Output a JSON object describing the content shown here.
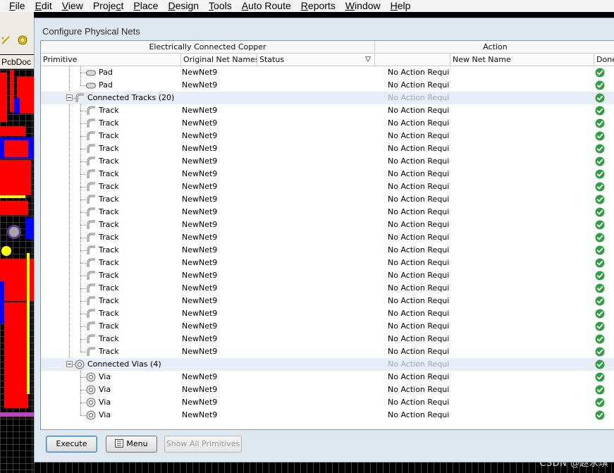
{
  "menu": [
    {
      "label": "File",
      "u": "F"
    },
    {
      "label": "Edit",
      "u": "E"
    },
    {
      "label": "View",
      "u": "V"
    },
    {
      "label": "Project",
      "u": "c"
    },
    {
      "label": "Place",
      "u": "P"
    },
    {
      "label": "Design",
      "u": "D"
    },
    {
      "label": "Tools",
      "u": "T"
    },
    {
      "label": "Auto Route",
      "u": "A"
    },
    {
      "label": "Reports",
      "u": "R"
    },
    {
      "label": "Window",
      "u": "W"
    },
    {
      "label": "Help",
      "u": "H"
    }
  ],
  "editor_tab": "PcbDoc *",
  "dialog": {
    "title": "Configure Physical Nets",
    "headers": {
      "group_copper": "Electrically Connected Copper",
      "group_action": "Action",
      "primitive": "Primitive",
      "original_net": "Original Net Names",
      "status": "Status",
      "new_net": "New Net Name",
      "done": "Done"
    },
    "rows": [
      {
        "kind": "item",
        "icon": "pad-icon",
        "primitive": "Pad",
        "net": "NewNet9",
        "action": "No Action Requir",
        "done": true
      },
      {
        "kind": "item",
        "icon": "pad-icon",
        "primitive": "Pad",
        "net": "NewNet9",
        "action": "No Action Requir",
        "done": true
      },
      {
        "kind": "group",
        "icon": "track-icon",
        "primitive": "Connected Tracks (20)",
        "net": "",
        "action": "No Action Requir",
        "done": true
      },
      {
        "kind": "item",
        "icon": "track-icon",
        "primitive": "Track",
        "net": "NewNet9",
        "action": "No Action Requir",
        "done": true
      },
      {
        "kind": "item",
        "icon": "track-icon",
        "primitive": "Track",
        "net": "NewNet9",
        "action": "No Action Requir",
        "done": true
      },
      {
        "kind": "item",
        "icon": "track-icon",
        "primitive": "Track",
        "net": "NewNet9",
        "action": "No Action Requir",
        "done": true
      },
      {
        "kind": "item",
        "icon": "track-icon",
        "primitive": "Track",
        "net": "NewNet9",
        "action": "No Action Requir",
        "done": true
      },
      {
        "kind": "item",
        "icon": "track-icon",
        "primitive": "Track",
        "net": "NewNet9",
        "action": "No Action Requir",
        "done": true
      },
      {
        "kind": "item",
        "icon": "track-icon",
        "primitive": "Track",
        "net": "NewNet9",
        "action": "No Action Requir",
        "done": true
      },
      {
        "kind": "item",
        "icon": "track-icon",
        "primitive": "Track",
        "net": "NewNet9",
        "action": "No Action Requir",
        "done": true
      },
      {
        "kind": "item",
        "icon": "track-icon",
        "primitive": "Track",
        "net": "NewNet9",
        "action": "No Action Requir",
        "done": true
      },
      {
        "kind": "item",
        "icon": "track-icon",
        "primitive": "Track",
        "net": "NewNet9",
        "action": "No Action Requir",
        "done": true
      },
      {
        "kind": "item",
        "icon": "track-icon",
        "primitive": "Track",
        "net": "NewNet9",
        "action": "No Action Requir",
        "done": true
      },
      {
        "kind": "item",
        "icon": "track-icon",
        "primitive": "Track",
        "net": "NewNet9",
        "action": "No Action Requir",
        "done": true
      },
      {
        "kind": "item",
        "icon": "track-icon",
        "primitive": "Track",
        "net": "NewNet9",
        "action": "No Action Requir",
        "done": true
      },
      {
        "kind": "item",
        "icon": "track-icon",
        "primitive": "Track",
        "net": "NewNet9",
        "action": "No Action Requir",
        "done": true
      },
      {
        "kind": "item",
        "icon": "track-icon",
        "primitive": "Track",
        "net": "NewNet9",
        "action": "No Action Requir",
        "done": true
      },
      {
        "kind": "item",
        "icon": "track-icon",
        "primitive": "Track",
        "net": "NewNet9",
        "action": "No Action Requir",
        "done": true
      },
      {
        "kind": "item",
        "icon": "track-icon",
        "primitive": "Track",
        "net": "NewNet9",
        "action": "No Action Requir",
        "done": true
      },
      {
        "kind": "item",
        "icon": "track-icon",
        "primitive": "Track",
        "net": "NewNet9",
        "action": "No Action Requir",
        "done": true
      },
      {
        "kind": "item",
        "icon": "track-icon",
        "primitive": "Track",
        "net": "NewNet9",
        "action": "No Action Requir",
        "done": true
      },
      {
        "kind": "item",
        "icon": "track-icon",
        "primitive": "Track",
        "net": "NewNet9",
        "action": "No Action Requir",
        "done": true
      },
      {
        "kind": "item",
        "icon": "track-icon",
        "primitive": "Track",
        "net": "NewNet9",
        "action": "No Action Requir",
        "done": true
      },
      {
        "kind": "group",
        "icon": "via-icon",
        "primitive": "Connected Vias (4)",
        "net": "",
        "action": "No Action Requir",
        "done": true
      },
      {
        "kind": "item",
        "icon": "via-icon",
        "primitive": "Via",
        "net": "NewNet9",
        "action": "No Action Requir",
        "done": true
      },
      {
        "kind": "item",
        "icon": "via-icon",
        "primitive": "Via",
        "net": "NewNet9",
        "action": "No Action Requir",
        "done": true
      },
      {
        "kind": "item",
        "icon": "via-icon",
        "primitive": "Via",
        "net": "NewNet9",
        "action": "No Action Requir",
        "done": true
      },
      {
        "kind": "item",
        "icon": "via-icon",
        "primitive": "Via",
        "net": "NewNet9",
        "action": "No Action Requir",
        "done": true
      }
    ],
    "buttons": {
      "execute": "Execute",
      "menu": "Menu",
      "show_all": "Show All Primitives"
    }
  },
  "watermark": "CSDN @赵永琪",
  "colors": {
    "done_green": "#2ea043",
    "group_row": "#e7ecf6",
    "pcb_red": "#ff0000",
    "pcb_blue": "#0000ff",
    "pcb_yellow": "#ffff00"
  }
}
